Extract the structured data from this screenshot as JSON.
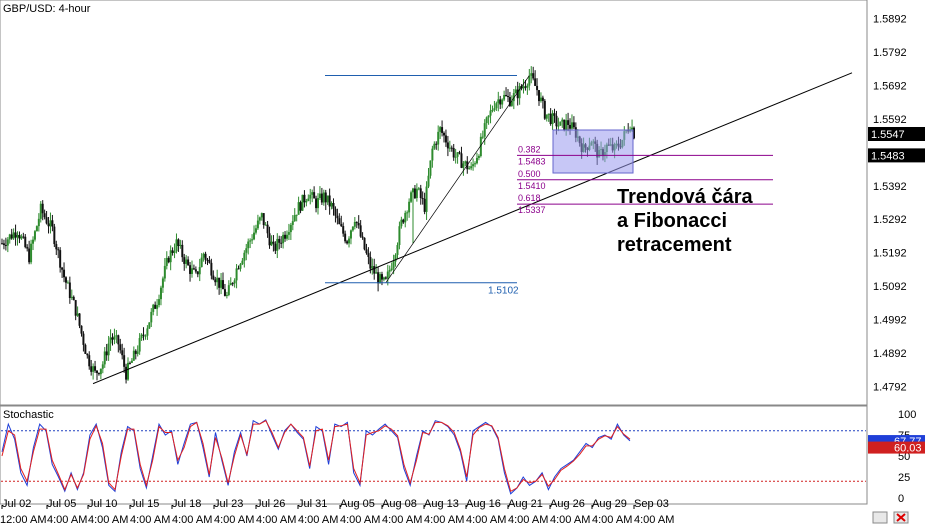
{
  "title": "GBP/USD: 4-hour",
  "annotation": [
    "Trendová čára",
    "a Fibonacci",
    "retracement"
  ],
  "colors": {
    "up": "#2e8b2e",
    "down": "#111111",
    "k_line": "#1f3fd8",
    "d_line": "#e02020",
    "fib": "#8b008b",
    "box": "#9999ee",
    "swing": "#1f5faf",
    "level_dot": "#2040c0"
  },
  "chart_data": [
    {
      "type": "candlestick",
      "title": "GBP/USD: 4-hour",
      "ylim": [
        1.4742,
        1.5942
      ],
      "y_ticks": [
        1.5892,
        1.5792,
        1.5692,
        1.5592,
        1.5392,
        1.5292,
        1.5192,
        1.5092,
        1.4992,
        1.4892,
        1.4792
      ],
      "price_tags": [
        1.5547,
        1.5483
      ],
      "x_ticks": [
        "Jul 02 12:00 AM",
        "Jul 05 4:00 AM",
        "Jul 10 4:00 AM",
        "Jul 15 4:00 AM",
        "Jul 18 4:00 AM",
        "Jul 23 4:00 AM",
        "Jul 26 4:00 AM",
        "Jul 31 4:00 AM",
        "Aug 05 4:00 AM",
        "Aug 08 4:00 AM",
        "Aug 13 4:00 AM",
        "Aug 16 4:00 AM",
        "Aug 21 4:00 AM",
        "Aug 26 4:00 AM",
        "Aug 29 4:00 AM",
        "Sep 03 4:00 AM"
      ],
      "close_path": [
        [
          0,
          1.522
        ],
        [
          8,
          1.526
        ],
        [
          14,
          1.518
        ],
        [
          20,
          1.532
        ],
        [
          26,
          1.526
        ],
        [
          32,
          1.512
        ],
        [
          38,
          1.502
        ],
        [
          44,
          1.488
        ],
        [
          48,
          1.483
        ],
        [
          52,
          1.486
        ],
        [
          56,
          1.494
        ],
        [
          60,
          1.492
        ],
        [
          64,
          1.483
        ],
        [
          68,
          1.488
        ],
        [
          74,
          1.496
        ],
        [
          80,
          1.505
        ],
        [
          86,
          1.518
        ],
        [
          90,
          1.522
        ],
        [
          96,
          1.515
        ],
        [
          100,
          1.512
        ],
        [
          104,
          1.519
        ],
        [
          110,
          1.512
        ],
        [
          116,
          1.506
        ],
        [
          122,
          1.516
        ],
        [
          128,
          1.523
        ],
        [
          134,
          1.53
        ],
        [
          140,
          1.52
        ],
        [
          146,
          1.525
        ],
        [
          152,
          1.532
        ],
        [
          158,
          1.537
        ],
        [
          162,
          1.534
        ],
        [
          166,
          1.536
        ],
        [
          170,
          1.533
        ],
        [
          174,
          1.527
        ],
        [
          178,
          1.523
        ],
        [
          182,
          1.53
        ],
        [
          186,
          1.522
        ],
        [
          190,
          1.515
        ],
        [
          196,
          1.51
        ],
        [
          198,
          1.5102
        ],
        [
          202,
          1.518
        ],
        [
          206,
          1.528
        ],
        [
          210,
          1.535
        ],
        [
          214,
          1.538
        ],
        [
          218,
          1.533
        ],
        [
          222,
          1.55
        ],
        [
          226,
          1.556
        ],
        [
          230,
          1.552
        ],
        [
          234,
          1.548
        ],
        [
          238,
          1.546
        ],
        [
          242,
          1.544
        ],
        [
          246,
          1.55
        ],
        [
          250,
          1.558
        ],
        [
          254,
          1.564
        ],
        [
          258,
          1.566
        ],
        [
          262,
          1.565
        ],
        [
          266,
          1.567
        ],
        [
          270,
          1.57
        ],
        [
          272,
          1.5722
        ],
        [
          276,
          1.568
        ],
        [
          280,
          1.561
        ],
        [
          284,
          1.559
        ],
        [
          288,
          1.557
        ],
        [
          292,
          1.558
        ],
        [
          296,
          1.555
        ],
        [
          300,
          1.55
        ],
        [
          304,
          1.553
        ],
        [
          308,
          1.548
        ],
        [
          312,
          1.551
        ],
        [
          316,
          1.55
        ],
        [
          320,
          1.553
        ],
        [
          324,
          1.558
        ],
        [
          326,
          1.555
        ]
      ],
      "fibonacci": [
        {
          "ratio": "0.382",
          "price": "1.5483"
        },
        {
          "ratio": "0.500",
          "price": "1.5410"
        },
        {
          "ratio": "0.618",
          "price": "1.5337"
        }
      ],
      "swing_low_label": "1.5102",
      "swing_high": 1.5722
    },
    {
      "type": "line",
      "title": "Stochastic",
      "ylim": [
        0,
        100
      ],
      "y_ticks": [
        100,
        75,
        50,
        25,
        0
      ],
      "levels": [
        80,
        20
      ],
      "value_tags": [
        "67.77",
        "60.03"
      ],
      "series": [
        {
          "name": "",
          "values": [
            55,
            88,
            70,
            30,
            15,
            60,
            88,
            80,
            40,
            25,
            8,
            30,
            10,
            30,
            75,
            88,
            60,
            15,
            8,
            55,
            85,
            80,
            35,
            12,
            50,
            88,
            75,
            80,
            40,
            65,
            88,
            90,
            60,
            25,
            78,
            45,
            15,
            55,
            78,
            50,
            92,
            88,
            93,
            75,
            58,
            80,
            88,
            78,
            70,
            35,
            85,
            80,
            40,
            88,
            85,
            90,
            30,
            15,
            80,
            75,
            82,
            88,
            80,
            72,
            35,
            15,
            50,
            80,
            75,
            92,
            90,
            85,
            75,
            55,
            20,
            80,
            85,
            90,
            85,
            70,
            30,
            5,
            12,
            25,
            15,
            20,
            30,
            10,
            25,
            35,
            40,
            45,
            55,
            65,
            60,
            72,
            75,
            70,
            88,
            75,
            68
          ]
        },
        {
          "name": "",
          "values": [
            50,
            80,
            75,
            35,
            20,
            55,
            82,
            82,
            45,
            28,
            10,
            28,
            12,
            28,
            70,
            86,
            65,
            18,
            10,
            50,
            82,
            82,
            40,
            15,
            45,
            85,
            78,
            78,
            45,
            60,
            85,
            90,
            65,
            28,
            72,
            48,
            18,
            50,
            75,
            52,
            88,
            88,
            92,
            78,
            60,
            78,
            88,
            80,
            72,
            38,
            80,
            82,
            45,
            85,
            86,
            88,
            35,
            18,
            75,
            78,
            80,
            86,
            82,
            74,
            40,
            18,
            45,
            78,
            76,
            90,
            90,
            86,
            78,
            58,
            25,
            75,
            84,
            88,
            86,
            72,
            35,
            8,
            12,
            22,
            18,
            20,
            28,
            14,
            22,
            33,
            38,
            44,
            52,
            62,
            62,
            70,
            74,
            72,
            85,
            76,
            70
          ]
        }
      ]
    }
  ],
  "footer": [
    "12:00 AM",
    "4:00 AM",
    "4:00 AM",
    "4:00 AM",
    "4:00 AM",
    "4:00 AM",
    "4:00 AM",
    "4:00 AM",
    "4:00 AM",
    "4:00 AM",
    "4:00 AM",
    "4:00 AM",
    "4:00 AM",
    "4:00 AM",
    "4:00 AM",
    "4:00 AM",
    "4:00 AM"
  ]
}
